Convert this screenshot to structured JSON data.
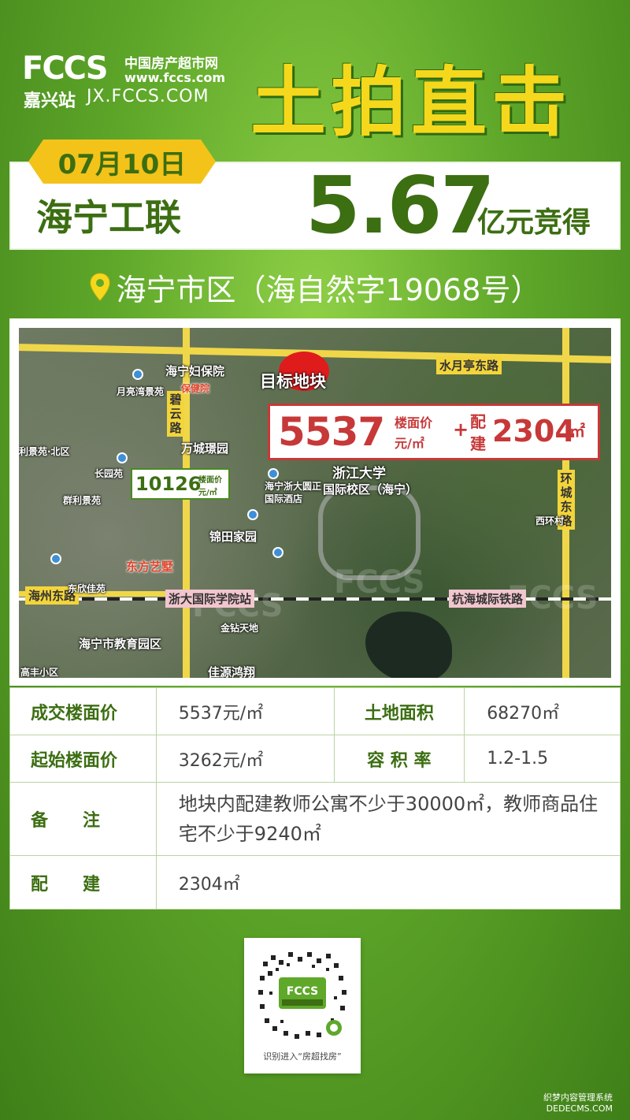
{
  "brand": {
    "logo_text": "FCCS",
    "cn_name": "中国房产超市网",
    "url": "www.fccs.com",
    "station": "嘉兴站",
    "domain": "JX.FCCS.COM"
  },
  "headline": "土拍直击",
  "deal": {
    "date": "07月10日",
    "buyer": "海宁工联",
    "price": "5.67",
    "price_unit": "亿元竞得"
  },
  "location": "海宁市区（海自然字19068号）",
  "map": {
    "target_label": "目标地块",
    "callout": {
      "floor_price": "5537",
      "unit_line1": "楼面价",
      "unit_line2": "元/㎡",
      "plus": "+",
      "extra_line1": "配",
      "extra_line2": "建",
      "extra_area": "2304",
      "extra_unit": "㎡"
    },
    "nearby_tag": {
      "price": "10126",
      "unit_line1": "楼面价",
      "unit_line2": "元/㎡"
    },
    "labels": {
      "hospital": "海宁妇保院",
      "hospital_sub": "保健院",
      "yuehu": "月亮湾景苑",
      "biyun_road": "碧云路",
      "wancheng": "万城璟园",
      "lijing": "利景苑·北区",
      "changyuan": "长园苑",
      "qunli": "群利景苑",
      "zju": "浙江大学",
      "zju_campus": "国际校区（海宁）",
      "hotel": "海宁浙大圆正",
      "hotel2": "国际酒店",
      "jintian": "锦田家园",
      "dongfang": "东方艺墅",
      "shuiyueting": "水月亭东路",
      "huancheng": "环城东路",
      "xicun": "西环村",
      "haizhou": "海州东路",
      "zju_station": "浙大国际学院站",
      "hanghai": "杭海城际铁路",
      "jinzuan": "金钻天地",
      "education": "海宁市教育园区",
      "gaofeng": "高丰小区",
      "jiayuan": "佳源鸿翔",
      "dongxin": "东欣佳苑"
    },
    "watermark": "FCCS"
  },
  "table": {
    "deal_price_label": "成交楼面价",
    "deal_price_value": "5537元/㎡",
    "area_label": "土地面积",
    "area_value": "68270㎡",
    "start_price_label": "起始楼面价",
    "start_price_value": "3262元/㎡",
    "ratio_label": "容 积 率",
    "ratio_value": "1.2-1.5",
    "note_label": "备　　注",
    "note_value": "地块内配建教师公寓不少于30000㎡，教师商品住宅不少于9240㎡",
    "extra_label": "配　　建",
    "extra_value": "2304㎡"
  },
  "qr": {
    "caption": "识别进入“房超找房”"
  },
  "footer": {
    "line1": "织梦内容管理系统",
    "line2": "DEDECMS.COM"
  },
  "colors": {
    "accent_green": "#3c6e12",
    "headline_yellow": "#f5d81c",
    "callout_red": "#c73838"
  }
}
